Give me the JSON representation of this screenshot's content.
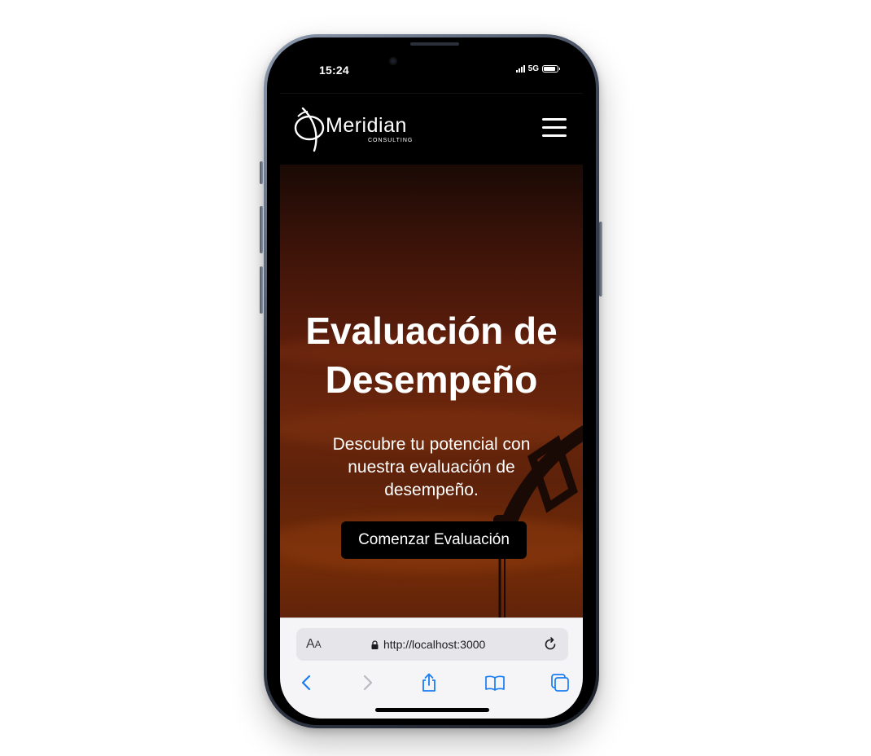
{
  "status_bar": {
    "time": "15:24",
    "network": "5G",
    "battery_level": 0.9
  },
  "site": {
    "logo": {
      "name": "Meridian",
      "subtitle": "CONSULTING"
    },
    "menu_icon": "hamburger-menu-icon"
  },
  "hero": {
    "title_line1": "Evaluación de",
    "title_line2": "Desempeño",
    "subtitle": "Descubre tu potencial con nuestra evaluación de desempeño.",
    "cta_label": "Comenzar Evaluación"
  },
  "browser": {
    "text_size_label": "A",
    "text_size_label_small": "A",
    "url": "http://localhost:3000",
    "icons": {
      "lock": "lock-icon",
      "reload": "reload-icon",
      "back": "chevron-left-icon",
      "forward": "chevron-right-icon",
      "share": "share-icon",
      "bookmarks": "book-icon",
      "tabs": "tabs-icon"
    },
    "accent_color": "#1a7cf2"
  },
  "colors": {
    "header_bg": "#000000",
    "hero_gradient_top": "#1a0a05",
    "hero_gradient_bottom": "#742c08",
    "cta_bg": "#000000",
    "browser_bar_bg": "#f5f5f7"
  }
}
